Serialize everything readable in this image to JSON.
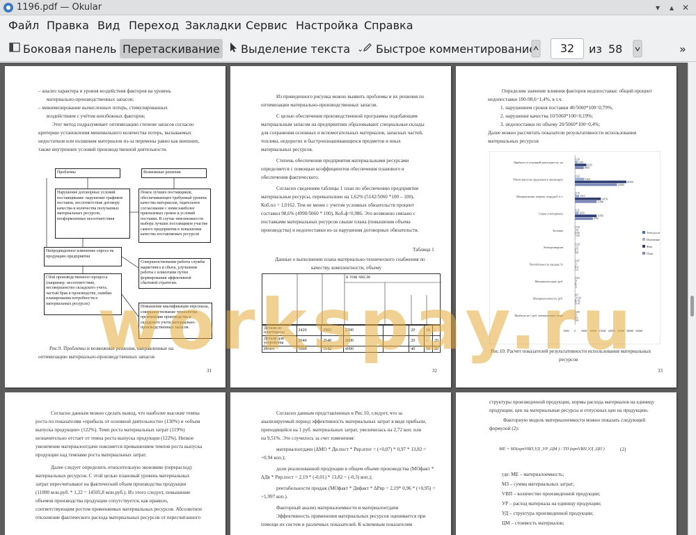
{
  "window": {
    "title": "1196.pdf — Okular"
  },
  "menu": [
    "Файл",
    "Правка",
    "Вид",
    "Переход",
    "Закладки",
    "Сервис",
    "Настройка",
    "Справка"
  ],
  "toolbar": {
    "sidebar": "Боковая панель",
    "drag": "Перетаскивание",
    "text_select": "Выделение текста",
    "quick_comment": "Быстрое комментирование",
    "current_page": "32",
    "of_label": "из",
    "total_pages": "58"
  },
  "watermark": "workspay.ru",
  "pages": {
    "p31": {
      "number": "31",
      "lines": [
        "–  анализ  характера  и  уровня  воздействия  факторов  на  уровень",
        "материально-производственных запасов;",
        "–  минимизирование    вычисленных    потерь,    стимулированных",
        "воздействием с учётом неизбежных факторов;",
        "Этот  метод  подразумевает  оптимизацию  степени  запасов  согласно",
        "критерию  установления  минимального  количества  потерь,  вызываемых",
        "недостатком или излишком материалов из-за перемены равно как внешних,",
        "также внутренних условий производственной деятельности."
      ],
      "caption": [
        "Рис.9.   Проблемы   и   возможные   решения,   направленные   на",
        "оптимизацию материально-производственных запасов"
      ],
      "boxes": {
        "problems": "Проблемы",
        "solutions": "Возможные решения",
        "b1": "Нарушение договорных условий поставщиками: нарушение графиков поставок, несоответствие договору качества и количества получаемых материальных ресурсов, неоформленные несоответствия",
        "b2": "Поиск лучших поставщиков, обеспечивающих требуемый уровень качества материалов, тщательное согласование с ними наиболее приемлемых сроков и условий поставки. В случае невозможности выбора лучших поставщиков участие самого предприятия в повышении качества поставляемых ресурсов",
        "b3": "Непредвиденное изменение спроса на продукцию предприятия",
        "b4": "Совершенствование работы службы маркетинга и сбыта, улучшение работы с клиентами путем формирования эффективной сбытовой стратегии.",
        "b5": "Сбой производственного процесса (например: несоответствие, несовершенство складского учета, частый брак в производстве, ошибки планирования потребности в материальных ресурсах)",
        "b6": "Повышение квалификации персонала, совершенствование технологии организации производства и складского учета материально-производственных запасов."
      }
    },
    "p32": {
      "number": "32",
      "lines": [
        "Из приведенного рисунка можно выявить проблемы и их решения по",
        "оптимизации материально-производственных запасов.",
        "С  целью  обеспечения  производственной  программы  подобающим",
        "материальным запасом на предприятиях образовывают специальные склады",
        "для сохранения основных и вспомогательных материалов, запасных частей,",
        "топлива,  недорогих  и  быстроизнашивающихся  предметов  и  иных",
        "материальных ресурсов.",
        "Степень    обеспечения    предприятия    материальными    ресурсами",
        "определяется  с  помощью  коэффициентов  обеспечения  планового  и",
        "обеспечения фактического.",
        "Согласно  сведениям  таблицы  1  план  по  обеспечению  предприятия",
        "материальные  ресурсы,  перевыполнен  на  1,62%   (5142/5060 *100 – 100),",
        "Коб.пл = 1,0162. Тем не менее с учетом условных обязательств процент",
        "составил  98,6%  (4990/5060 * 100),  Коб.ф=0,986.  Это  возможно  связано  с",
        "поставками  материальных  ресурсов  свыше  плана  (повышения  объема",
        "производства) и недопоставки из-за нарушения договорных обязательств."
      ],
      "table_label": "Таблица 1",
      "table_title": [
        "Данные о выполнении плана материально-технического снабжения по",
        "качеству, комплектности, объему"
      ],
      "table_header": "в том числе",
      "table_rows": [
        [
          "Детали из пластмассы",
          "2420",
          "2502",
          "2390",
          "",
          "20",
          "10",
          "–"
        ],
        [
          "Детали для устройства",
          "2640",
          "2640",
          "2600",
          "",
          "20",
          "–",
          "20"
        ],
        [
          "Итого",
          "5060",
          "5142",
          "4990",
          "",
          "40",
          "10",
          "20"
        ]
      ]
    },
    "p33": {
      "number": "33",
      "lines": [
        "Определим значение влияния факторов недопоставки: общий процент",
        "недопоставки 100-98,6=1,4%, в т.ч.",
        "1.      нарушением сроков поставки 40/5060*100=0,79%;",
        "2.      нарушение качества 10/5060*100=0,19%;",
        "3.      недопоставки по объему 20/5060*100=0,4%;",
        "Далее  можно  рассчитать  показатели  результативности  использования",
        "материальных ресурсов"
      ],
      "caption": [
        "Рис.10.  Расчет  показателей  результативности  использования  материальных",
        "ресурсов"
      ]
    },
    "p34": {
      "lines": [
        "Согласно данным можно сделать вывод, что наиболее высокие темпы",
        "роста по показателям «прибыль от основной деятельности» (130%) и «объем",
        "выпуска продукции» (122%). Темп роста материальных затрат (119%)",
        "незначительно отстает от темпа роста выпуска продукции (122%). Низкое",
        "увеличение материалоотдачи поясняется превышением темпов роста выпуска",
        "продукции над темпами роста материальных затрат.",
        "Далее  следует  определить  относительную  экономию  (перерасход)",
        "материальных ресурсов.  С  этой  целью  плановый  уровень  материальных",
        "затрат  пересчитывают  на  фактический  объем  производства  продукции",
        "(11890 млн.руб. * 1,22 = 14505,8 млн.руб.). Из этого следует, повышение",
        "объемов    производства    продукции    сопутствуется,    как    правило,",
        "соответствующим ростом применяемых материальных ресурсов. Абсолютное",
        "отклонение фактического расхода материальных ресурсов от пересчитанного"
      ]
    },
    "p35": {
      "lines": [
        "Согласно   данным   представленных   в   Рис.10,   следует,   что   за",
        "анализируемый период эффективность материальных затрат в виде прибыли,",
        "приходящейся на 1 руб. материальных затрат, увеличилась на 2,72 коп. или",
        "на 9,51%. Это случилось за счет изменения:",
        "материалоотдачи  (ΔМО * Дв.пост * Рвр.итог = (+0,07) * 0,97 * 13,82 =",
        "+0,94 коп.);",
        "доли реализованной продукции в общем объеме производства (МОфакт *",
        "ΔДв * Рвр.пост = 2,19 * (-0,01) * 13,82 = (-0,3) коп.);",
        "рентабельности продаж (МОфакт * Двфакт * ΔРвр = 2,19* 0,96 * (+0,95) =",
        "+1,997 коп.).",
        "Факторный анализ материалоемкости и материалоотдачи",
        "Эффективность  применения  материальных  ресурсов  оценивается  при",
        "помощи  их  систем  и  различных  показателей.  К  ключевым  показателям"
      ]
    },
    "p36": {
      "lines": [
        "структуры произведенной продукции, нормы расхода материалов на единицу",
        "продукции, цен на материальные ресурсы и отпускных цен на продукцию.",
        "Факторную   модель   материалоемкости   можно   показать   следующей",
        "формулой (2):"
      ],
      "formula": "МЕ = МЗ(крпVВП,УД ,УР ,ЦМ ) / ТП (крпVВП,УД ,ЦП )",
      "formula_num": "(2)",
      "defs": [
        "где: МЕ – материалоемкость;",
        "МЗ – сумма материальных затрат;",
        "VВП – количество произведенной продукции;",
        "УР – расход материала на единицу продукции;",
        "УД – структура произведенной продукции;",
        "ЦМ – стоимость материалов;"
      ]
    }
  },
  "chart_data": {
    "type": "bar",
    "orientation": "horizontal",
    "categories": [
      "Прибыль от основной деятельности, млрд.руб.",
      "Объем выпуска продукции в анализируемом период, млрд.руб.",
      "Материальные затраты, млрд.руб. в т.ч.",
      "Сырье и материалы",
      "Топливо",
      "Электроэнергия",
      "Рентабельность продаж, %",
      "Материалоотдача, руб.",
      "Материалоемкость, руб.",
      "Прибыль на 1 руб. материальных затрат, коп."
    ],
    "series": [
      {
        "name": "Темп роста",
        "values": [
          130,
          122,
          119,
          121,
          130,
          120,
          107,
          103,
          97,
          109
        ]
      },
      {
        "name": "Изменение",
        "values": [
          1430,
          5100,
          2310,
          2060,
          50,
          12,
          1,
          0,
          -0.02,
          3
        ]
      },
      {
        "name": "Факт",
        "values": [
          6230,
          28100,
          14150,
          11850,
          200,
          72,
          14,
          2,
          0.45,
          31
        ]
      },
      {
        "name": "План",
        "values": [
          4800,
          23000,
          11890,
          9790,
          150,
          60,
          13,
          2,
          0.47,
          29
        ]
      }
    ],
    "colors": [
      "#4a6fb0",
      "#9aaed0",
      "#2f3f73",
      "#7c8ab8"
    ],
    "xlim": [
      -5000,
      35000
    ],
    "xticks": [
      "-5000",
      "0",
      "5000",
      "10000",
      "15000",
      "20000",
      "25000",
      "30000",
      "35000"
    ],
    "legend": "right"
  }
}
